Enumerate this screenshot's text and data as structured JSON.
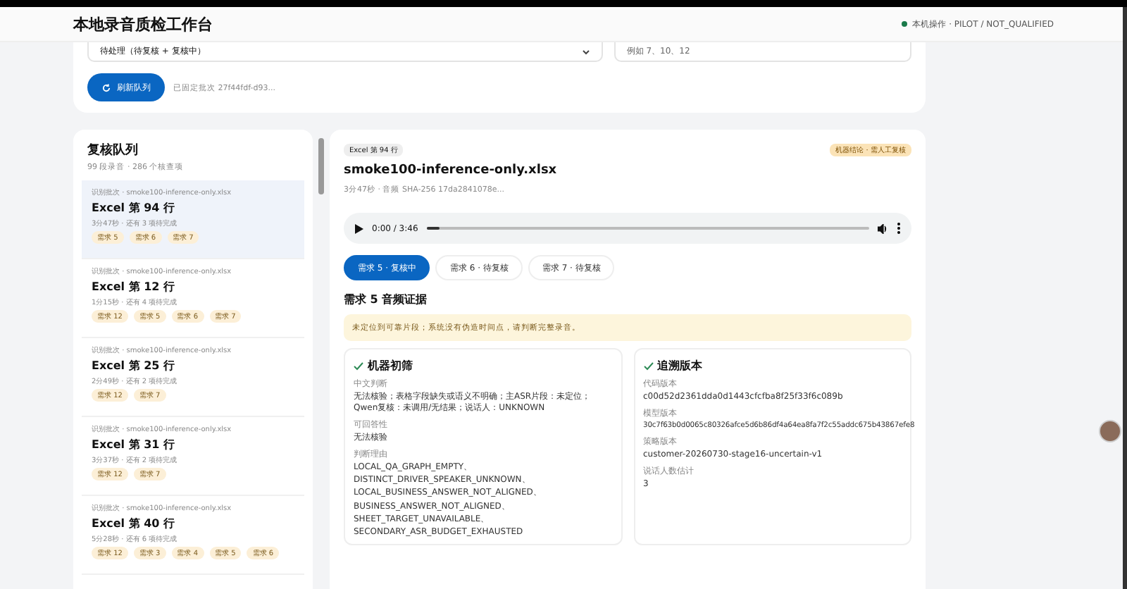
{
  "header": {
    "title": "本地录音质检工作台",
    "status": "本机操作 · PILOT / NOT_QUALIFIED"
  },
  "filters": {
    "status_select": "待处理（待复核 + 复核中）",
    "rows_field": {
      "placeholder": "例如 7、10、12"
    },
    "refresh_button": "刷新队列",
    "batch_note": "已固定批次 27f44fdf-d93..."
  },
  "queue": {
    "title": "复核队列",
    "summary": "99 段录音 · 286 个核查项",
    "items": [
      {
        "batch": "识别批次 · smoke100-inference-only.xlsx",
        "title": "Excel 第 94 行",
        "meta": "3分47秒 · 还有 3 项待完成",
        "tags": [
          "需求 5",
          "需求 6",
          "需求 7"
        ],
        "selected": true
      },
      {
        "batch": "识别批次 · smoke100-inference-only.xlsx",
        "title": "Excel 第 12 行",
        "meta": "1分15秒 · 还有 4 项待完成",
        "tags": [
          "需求 12",
          "需求 5",
          "需求 6",
          "需求 7"
        ],
        "selected": false
      },
      {
        "batch": "识别批次 · smoke100-inference-only.xlsx",
        "title": "Excel 第 25 行",
        "meta": "2分49秒 · 还有 2 项待完成",
        "tags": [
          "需求 12",
          "需求 7"
        ],
        "selected": false
      },
      {
        "batch": "识别批次 · smoke100-inference-only.xlsx",
        "title": "Excel 第 31 行",
        "meta": "3分37秒 · 还有 2 项待完成",
        "tags": [
          "需求 12",
          "需求 7"
        ],
        "selected": false
      },
      {
        "batch": "识别批次 · smoke100-inference-only.xlsx",
        "title": "Excel 第 40 行",
        "meta": "5分28秒 · 还有 6 项待完成",
        "tags": [
          "需求 12",
          "需求 3",
          "需求 4",
          "需求 5",
          "需求 6"
        ],
        "selected": false
      }
    ]
  },
  "detail": {
    "row_badge": "Excel 第 94 行",
    "verdict_badge": "机器结论 · 需人工复核",
    "file_name": "smoke100-inference-only.xlsx",
    "meta": "3分47秒 · 音频 SHA-256 17da2841078e...",
    "player": {
      "time": "0:00 / 3:46",
      "level": 0.03
    },
    "tabs": [
      {
        "label": "需求 5 · 复核中",
        "selected": true
      },
      {
        "label": "需求 6 · 待复核",
        "selected": false
      },
      {
        "label": "需求 7 · 待复核",
        "selected": false
      }
    ],
    "section_title": "需求 5 音频证据",
    "warning": "未定位到可靠片段；系统没有伪造时间点，请判断完整录音。",
    "cards": [
      {
        "title": "机器初筛",
        "fields": [
          {
            "label": "中文判断",
            "lines": [
              "无法核验；表格字段缺失或语义不明确；主ASR片段：未定位；Qwen复核：未调用/无结果；说话人：UNKNOWN"
            ]
          },
          {
            "label": "可回答性",
            "lines": [
              "无法核验"
            ]
          },
          {
            "label": "判断理由",
            "lines": [
              "LOCAL_QA_GRAPH_EMPTY、",
              "DISTINCT_DRIVER_SPEAKER_UNKNOWN、",
              "LOCAL_BUSINESS_ANSWER_NOT_ALIGNED、",
              "BUSINESS_ANSWER_NOT_ALIGNED、",
              "SHEET_TARGET_UNAVAILABLE、",
              "SECONDARY_ASR_BUDGET_EXHAUSTED"
            ]
          }
        ]
      },
      {
        "title": "追溯版本",
        "fields": [
          {
            "label": "代码版本",
            "lines": [
              "c00d52d2361dda0d1443cfcfba8f25f33f6c089b"
            ]
          },
          {
            "label": "模型版本",
            "kind": "code",
            "lines": [
              "30c7f63b0d0065c80326afce5d6b86df4a64ea8fa7f2c55addc675b43867efe8"
            ]
          },
          {
            "label": "策略版本",
            "lines": [
              "customer-20260730-stage16-uncertain-v1"
            ]
          },
          {
            "label": "说话人数估计",
            "lines": [
              "3"
            ]
          }
        ]
      }
    ]
  }
}
